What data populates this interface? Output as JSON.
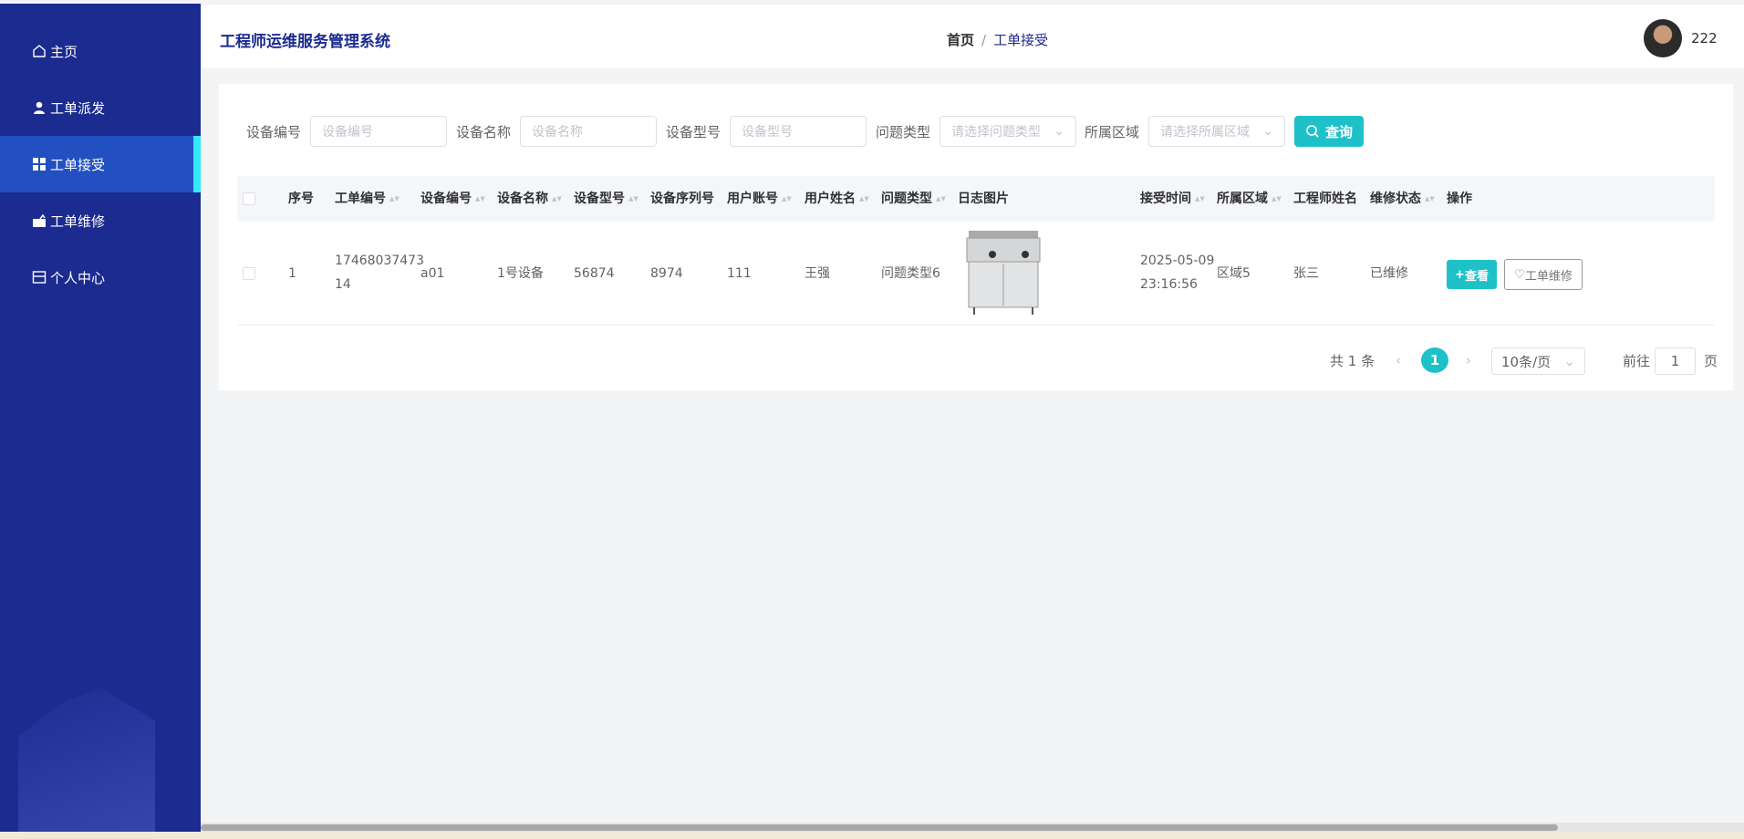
{
  "sidebar": {
    "items": [
      {
        "label": "主页",
        "icon": "home-icon"
      },
      {
        "label": "工单派发",
        "icon": "user-icon"
      },
      {
        "label": "工单接受",
        "icon": "grid-icon",
        "active": true
      },
      {
        "label": "工单维修",
        "icon": "briefcase-icon"
      },
      {
        "label": "个人中心",
        "icon": "card-icon"
      }
    ]
  },
  "header": {
    "title": "工程师运维服务管理系统",
    "breadcrumb": {
      "home": "首页",
      "sep": "/",
      "current": "工单接受"
    },
    "username": "222"
  },
  "filters": [
    {
      "label": "设备编号",
      "placeholder": "设备编号"
    },
    {
      "label": "设备名称",
      "placeholder": "设备名称"
    },
    {
      "label": "设备型号",
      "placeholder": "设备型号"
    },
    {
      "label": "问题类型",
      "placeholder": "请选择问题类型"
    },
    {
      "label": "所属区域",
      "placeholder": "请选择所属区域"
    }
  ],
  "query_label": "查询",
  "table": {
    "columns": [
      "序号",
      "工单编号",
      "设备编号",
      "设备名称",
      "设备型号",
      "设备序列号",
      "用户账号",
      "用户姓名",
      "问题类型",
      "日志图片",
      "接受时间",
      "所属区域",
      "工程师姓名",
      "维修状态",
      "操作"
    ],
    "rows": [
      {
        "index": "1",
        "order_no_1": "17468037473",
        "order_no_2": "14",
        "device_no": "a01",
        "device_name": "1号设备",
        "model": "56874",
        "serial": "8974",
        "account": "111",
        "user_name": "王强",
        "problem": "问题类型6",
        "time_1": "2025-05-09",
        "time_2": "23:16:56",
        "region": "区域5",
        "engineer": "张三",
        "status": "已维修",
        "view_label": "查看",
        "repair_label": "工单维修"
      }
    ]
  },
  "pagination": {
    "total": "共 1 条",
    "current": "1",
    "page_size": "10条/页",
    "goto_label": "前往",
    "goto_value": "1",
    "page_suffix": "页"
  },
  "colors": {
    "sidebar": "#1b2b8f",
    "active": "#2250c0",
    "accent": "#1fc1c9"
  }
}
